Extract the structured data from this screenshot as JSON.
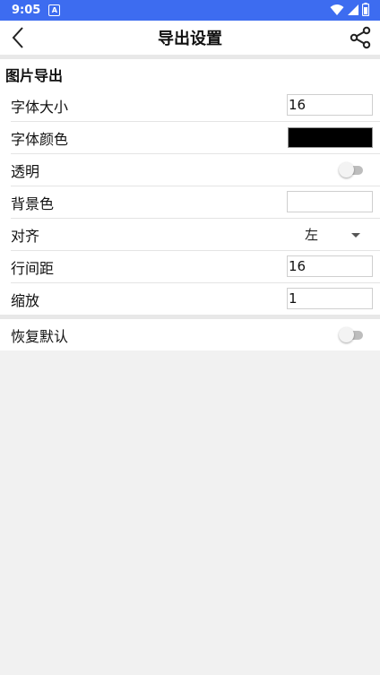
{
  "status": {
    "time": "9:05",
    "notif_letter": "A"
  },
  "appbar": {
    "title": "导出设置"
  },
  "section": {
    "header": "图片导出",
    "rows": {
      "font_size": {
        "label": "字体大小",
        "value": "16"
      },
      "font_color": {
        "label": "字体颜色",
        "color": "#000000"
      },
      "transparent": {
        "label": "透明",
        "on": false
      },
      "background": {
        "label": "背景色",
        "color": "#ffffff"
      },
      "align": {
        "label": "对齐",
        "value": "左"
      },
      "line_spacing": {
        "label": "行间距",
        "value": "16"
      },
      "zoom": {
        "label": "缩放",
        "value": "1"
      }
    }
  },
  "reset": {
    "label": "恢复默认",
    "on": false
  },
  "colors": {
    "status_bar": "#3d6cf0"
  }
}
